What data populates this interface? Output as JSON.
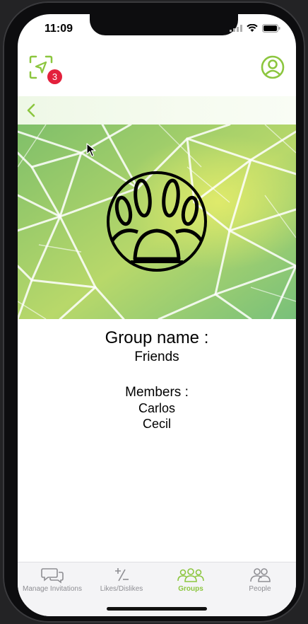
{
  "status": {
    "time": "11:09"
  },
  "header": {
    "notification_count": "3",
    "locate_icon": "location-arrow-icon",
    "profile_icon": "user-circle-icon"
  },
  "nav": {
    "back_icon": "chevron-left-icon"
  },
  "banner": {
    "emblem_icon": "paw-icon"
  },
  "group": {
    "name_heading": "Group name :",
    "name": "Friends",
    "members_heading": "Members :",
    "members": [
      "Carlos",
      "Cecil"
    ]
  },
  "tabs": [
    {
      "label": "Manage Invitations",
      "icon": "chat-bubbles-icon",
      "active": false
    },
    {
      "label": "Likes/Dislikes",
      "icon": "plus-minus-icon",
      "active": false
    },
    {
      "label": "Groups",
      "icon": "groups-icon",
      "active": true
    },
    {
      "label": "People",
      "icon": "people-icon",
      "active": false
    }
  ],
  "colors": {
    "accent": "#8cc63f",
    "badge": "#e3213c",
    "tab_inactive": "#8e8e93"
  }
}
